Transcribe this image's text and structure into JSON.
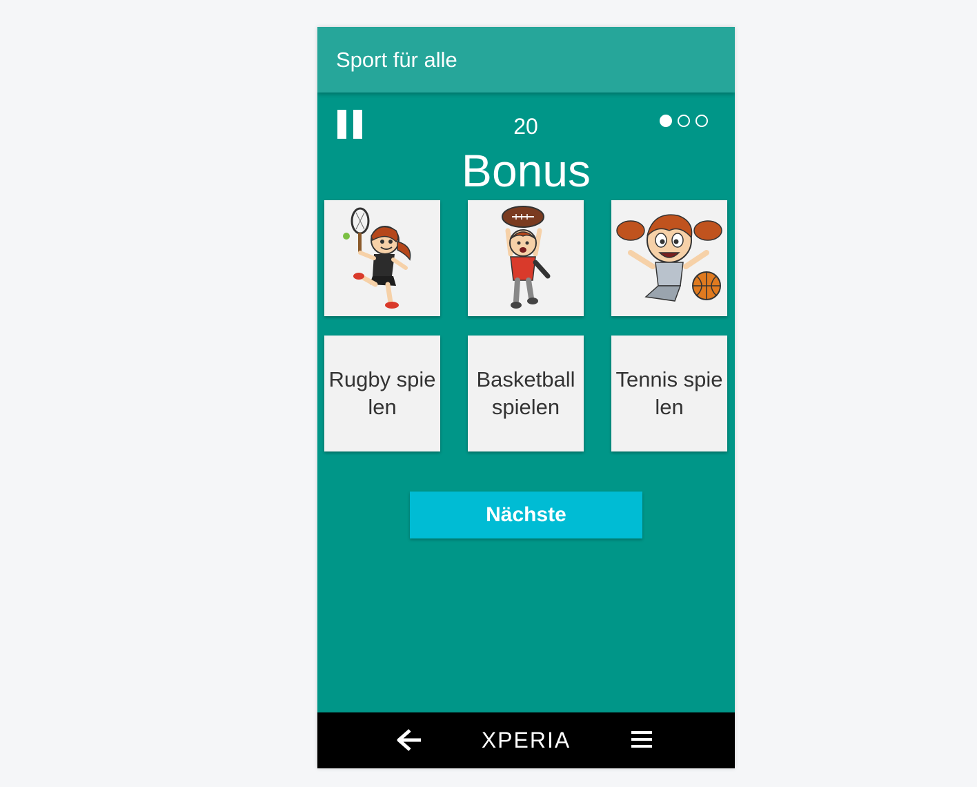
{
  "app": {
    "title": "Sport für alle"
  },
  "game": {
    "counter": "20",
    "heading": "Bonus",
    "progress_dots": [
      true,
      false,
      false
    ]
  },
  "picture_cards": [
    {
      "icon": "tennis-girl-icon"
    },
    {
      "icon": "rugby-boy-icon"
    },
    {
      "icon": "basketball-girl-icon"
    }
  ],
  "word_cards": [
    {
      "label": "Rugby spielen"
    },
    {
      "label": "Basketball spielen"
    },
    {
      "label": "Tennis spielen"
    }
  ],
  "next_button": {
    "label": "Nächste"
  },
  "navbar": {
    "brand": "XPERIA",
    "back_icon": "back-arrow-icon",
    "menu_icon": "menu-icon"
  },
  "colors": {
    "background": "#009688",
    "appbar": "#26a69a",
    "button": "#00bcd4",
    "card": "#f2f2f2"
  }
}
